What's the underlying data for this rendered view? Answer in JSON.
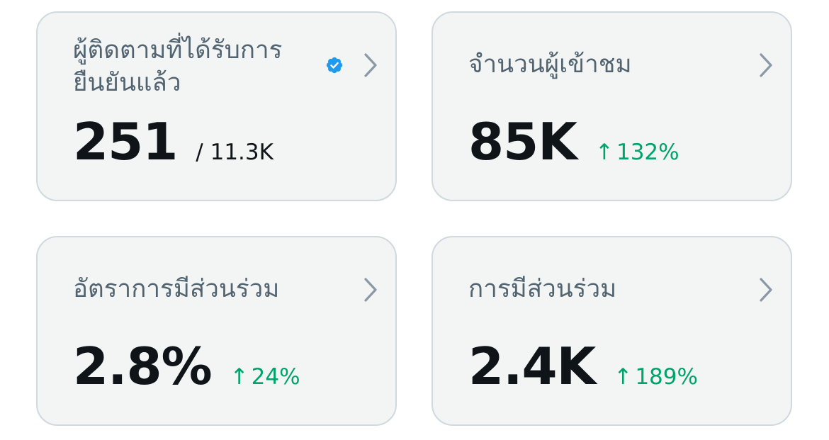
{
  "colors": {
    "card_bg": "#f3f5f5",
    "card_border": "#cfd9de",
    "title": "#536471",
    "value": "#0f1419",
    "positive_delta": "#00a36c",
    "verified_badge": "#1d9bf0",
    "chevron": "#8b98a5"
  },
  "cards": [
    {
      "title": "ผู้ติดตามที่ได้รับการยืนยันแล้ว",
      "icon": "verified-badge-icon",
      "value": "251",
      "secondary": "/ 11.3K"
    },
    {
      "title": "จำนวนผู้เข้าชม",
      "value": "85K",
      "delta_arrow": "↑",
      "delta": "132%"
    },
    {
      "title": "อัตราการมีส่วนร่วม",
      "value": "2.8%",
      "delta_arrow": "↑",
      "delta": "24%"
    },
    {
      "title": "การมีส่วนร่วม",
      "value": "2.4K",
      "delta_arrow": "↑",
      "delta": "189%"
    }
  ]
}
